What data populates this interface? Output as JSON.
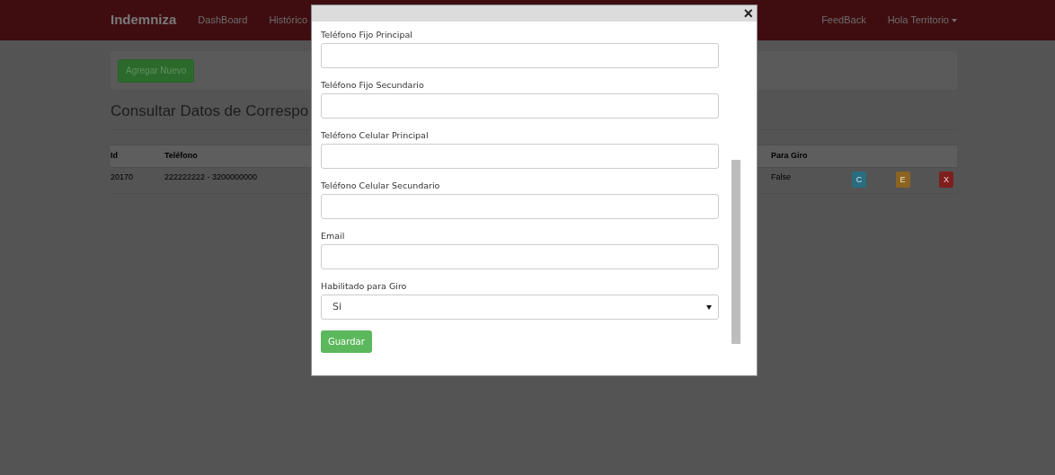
{
  "navbar": {
    "brand": "Indemniza",
    "links": [
      "DashBoard",
      "Histórico"
    ],
    "right_links": [
      "FeedBack"
    ],
    "user_menu": "Hola Territorio"
  },
  "toolbar": {
    "add_button": "Agregar Nuevo"
  },
  "page_title": "Consultar Datos de Correspo",
  "table": {
    "columns": [
      "Id",
      "Teléfono",
      "Para Giro"
    ],
    "rows": [
      {
        "id": "20170",
        "telefono": "222222222 - 3200000000",
        "para_giro": "False",
        "actions": [
          {
            "kind": "consult",
            "label": "C"
          },
          {
            "kind": "edit",
            "label": "E"
          },
          {
            "kind": "delete",
            "label": "X"
          }
        ]
      }
    ]
  },
  "modal": {
    "close": "×",
    "fields": [
      {
        "kind": "text",
        "label": "Teléfono Fijo Principal"
      },
      {
        "kind": "text",
        "label": "Teléfono Fijo Secundario"
      },
      {
        "kind": "text",
        "label": "Teléfono Celular Principal"
      },
      {
        "kind": "text",
        "label": "Teléfono Celular Secundario"
      },
      {
        "kind": "text",
        "label": "Email"
      },
      {
        "kind": "select",
        "label": "Habilitado para Giro",
        "value": "Si"
      }
    ],
    "submit": "Guardar"
  }
}
